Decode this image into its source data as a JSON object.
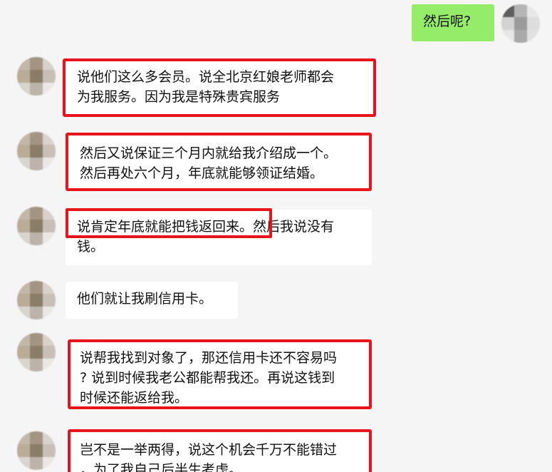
{
  "chat": {
    "messages": [
      {
        "text": "然后呢?"
      },
      {
        "text": "说他们这么多会员。说全北京红娘老师都会\n为我服务。因为我是特殊贵宾服务"
      },
      {
        "text": "然后又说保证三个月内就给我介绍成一个。\n然后再处六个月，年底就能够领证结婚。"
      },
      {
        "text": "说肯定年底就能把钱返回来。然后我说没有\n钱。"
      },
      {
        "text": "他们就让我刷信用卡。"
      },
      {
        "text": "说帮我找到对象了，那还信用卡还不容易吗\n? 说到时候我老公都能帮我还。再说这钱到\n时候还能返给我。"
      },
      {
        "text": "岂不是一举两得，说这个机会千万不能错过\n，为了我自己后半生考虑。"
      }
    ]
  },
  "colors": {
    "background": "#f5f5f5",
    "incoming_bubble": "#ffffff",
    "outgoing_bubble": "#95ec69",
    "highlight": "#e8141b"
  }
}
